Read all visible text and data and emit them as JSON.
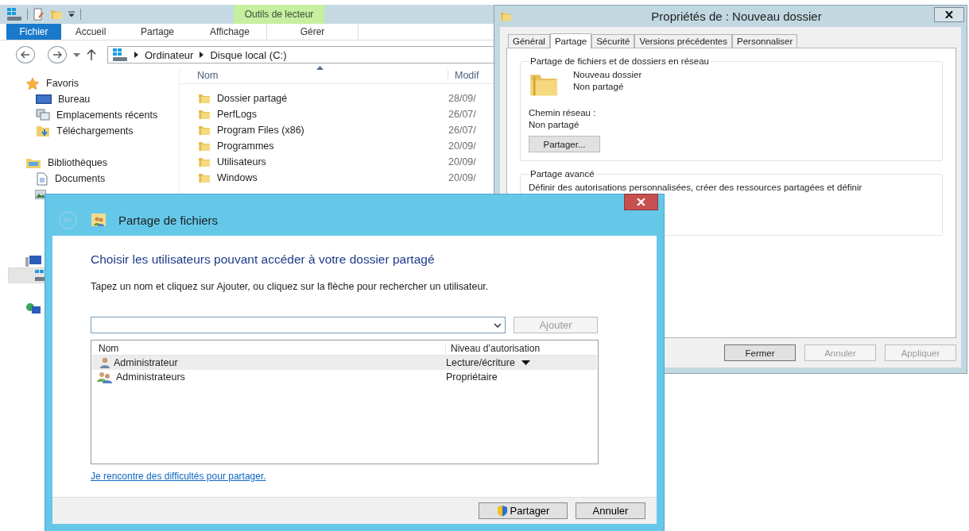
{
  "explorer": {
    "context_label": "Outils de lecteur",
    "ribbon_tabs": [
      {
        "label": "Fichier",
        "selected": true
      },
      {
        "label": "Accueil",
        "selected": false
      },
      {
        "label": "Partage",
        "selected": false
      },
      {
        "label": "Affichage",
        "selected": false
      },
      {
        "label": "Gérer",
        "selected": false
      }
    ],
    "breadcrumbs": [
      "Ordinateur",
      "Disque local (C:)"
    ],
    "nav_pane": [
      {
        "label": "Favoris",
        "kind": "star",
        "children": [
          {
            "label": "Bureau",
            "kind": "desktop"
          },
          {
            "label": "Emplacements récents",
            "kind": "recent"
          },
          {
            "label": "Téléchargements",
            "kind": "download"
          }
        ]
      },
      {
        "label": "Bibliothèques",
        "kind": "library",
        "children": [
          {
            "label": "Documents",
            "kind": "document"
          }
        ]
      }
    ],
    "columns": [
      "Nom",
      "Modif"
    ],
    "files": [
      {
        "name": "Dossier partagé",
        "date": "28/09/"
      },
      {
        "name": "PerfLogs",
        "date": "26/07/"
      },
      {
        "name": "Program Files (x86)",
        "date": "26/07/"
      },
      {
        "name": "Programmes",
        "date": "20/09/"
      },
      {
        "name": "Utilisateurs",
        "date": "20/09/"
      },
      {
        "name": "Windows",
        "date": "20/09/"
      }
    ]
  },
  "properties": {
    "title": "Propriétés de : Nouveau dossier",
    "tabs": [
      {
        "label": "Général",
        "selected": false
      },
      {
        "label": "Partage",
        "selected": true
      },
      {
        "label": "Sécurité",
        "selected": false
      },
      {
        "label": "Versions précédentes",
        "selected": false
      },
      {
        "label": "Personnaliser",
        "selected": false
      }
    ],
    "network_group": {
      "legend": "Partage de fichiers et de dossiers en réseau",
      "folder_name": "Nouveau dossier",
      "folder_status": "Non partagé",
      "path_label": "Chemin réseau :",
      "path_value": "Non partagé",
      "button": "Partager..."
    },
    "advanced_group": {
      "legend": "Partage avancé",
      "description": "Définir des autorisations personnalisées, créer des ressources partagées et définir"
    },
    "buttons": [
      {
        "label": "Fermer",
        "disabled": false
      },
      {
        "label": "Annuler",
        "disabled": true
      },
      {
        "label": "Appliquer",
        "disabled": true
      }
    ]
  },
  "dialog": {
    "title": "Partage de fichiers",
    "heading": "Choisir les utilisateurs pouvant accéder à votre dossier partagé",
    "instruction": "Tapez un nom et cliquez sur Ajouter, ou cliquez sur la flèche pour rechercher un utilisateur.",
    "add_button": {
      "label": "Ajouter",
      "disabled": true
    },
    "columns": [
      "Nom",
      "Niveau d’autorisation"
    ],
    "rows": [
      {
        "name": "Administrateur",
        "permission": "Lecture/écriture",
        "kind": "user",
        "selected": true
      },
      {
        "name": "Administrateurs",
        "permission": "Propriétaire",
        "kind": "group",
        "selected": false
      }
    ],
    "link": "Je rencontre des difficultés pour partager.",
    "buttons": [
      {
        "label": "Partager",
        "kind": "elevated"
      },
      {
        "label": "Annuler",
        "kind": "plain"
      }
    ]
  }
}
